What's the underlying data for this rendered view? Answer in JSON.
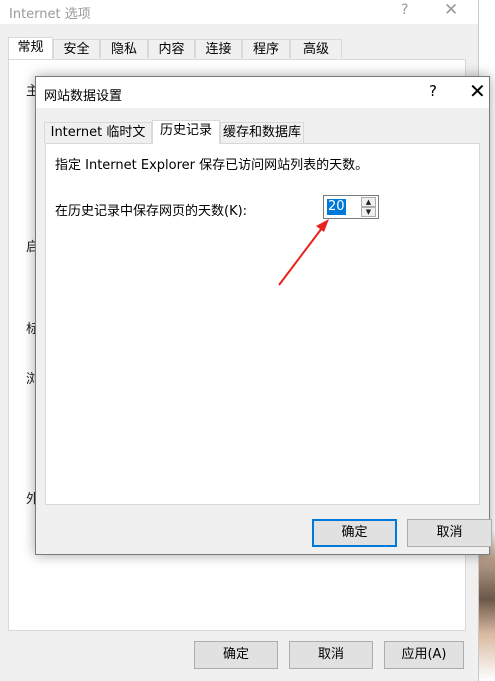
{
  "background_window": {
    "title": "Internet 选项",
    "help": "?",
    "close": "✕",
    "tabs": [
      "常规",
      "安全",
      "隐私",
      "内容",
      "连接",
      "程序",
      "高级"
    ],
    "peeks": [
      "主",
      "启",
      "标",
      "浏",
      "外"
    ],
    "buttons": {
      "ok": "确定",
      "cancel": "取消",
      "apply": "应用(A)"
    }
  },
  "dialog": {
    "title": "网站数据设置",
    "help": "?",
    "close": "✕",
    "tabs": [
      "Internet 临时文件",
      "历史记录",
      "缓存和数据库"
    ],
    "active_tab_index": 1,
    "description": "指定 Internet Explorer 保存已访问网站列表的天数。",
    "days_label": "在历史记录中保存网页的天数(K):",
    "days_value": "20",
    "buttons": {
      "ok": "确定",
      "cancel": "取消"
    }
  },
  "icons": {
    "spin_up": "▲",
    "spin_down": "▼"
  },
  "colors": {
    "accent": "#0078d7",
    "annotation_arrow": "#e8231f"
  }
}
